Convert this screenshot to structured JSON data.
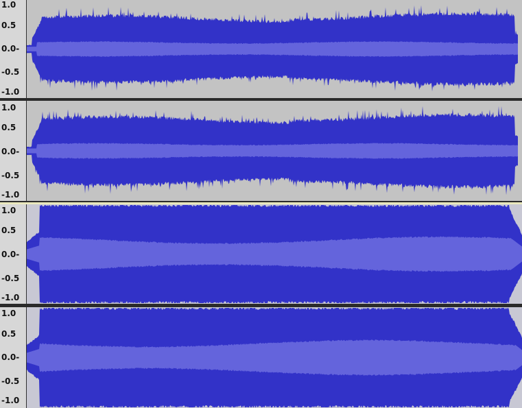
{
  "colors": {
    "wave_dark": "#3232c8",
    "wave_light": "#6464dc",
    "background": "#c3c3c3",
    "selection": "#c8c8d4",
    "ruler_bg": "#d7d7d7"
  },
  "tracks": [
    {
      "channels": [
        {
          "labels": [
            "1.0",
            "0.5",
            "0.0-",
            "-0.5",
            "-1.0"
          ],
          "peak": 0.55,
          "rms": 0.08,
          "selected": false
        },
        {
          "labels": [
            "1.0",
            "0.5",
            "0.0-",
            "-0.5",
            "-1.0"
          ],
          "peak": 0.55,
          "rms": 0.08,
          "selected": false
        }
      ]
    },
    {
      "channels": [
        {
          "labels": [
            "1.0",
            "0.5",
            "0.0-",
            "-0.5",
            "-1.0"
          ],
          "peak": 1.0,
          "rms": 0.35,
          "selected": true
        },
        {
          "labels": [
            "1.0",
            "0.5",
            "0.0-",
            "-0.5",
            "-1.0"
          ],
          "peak": 1.0,
          "rms": 0.35,
          "selected": true
        }
      ]
    }
  ]
}
